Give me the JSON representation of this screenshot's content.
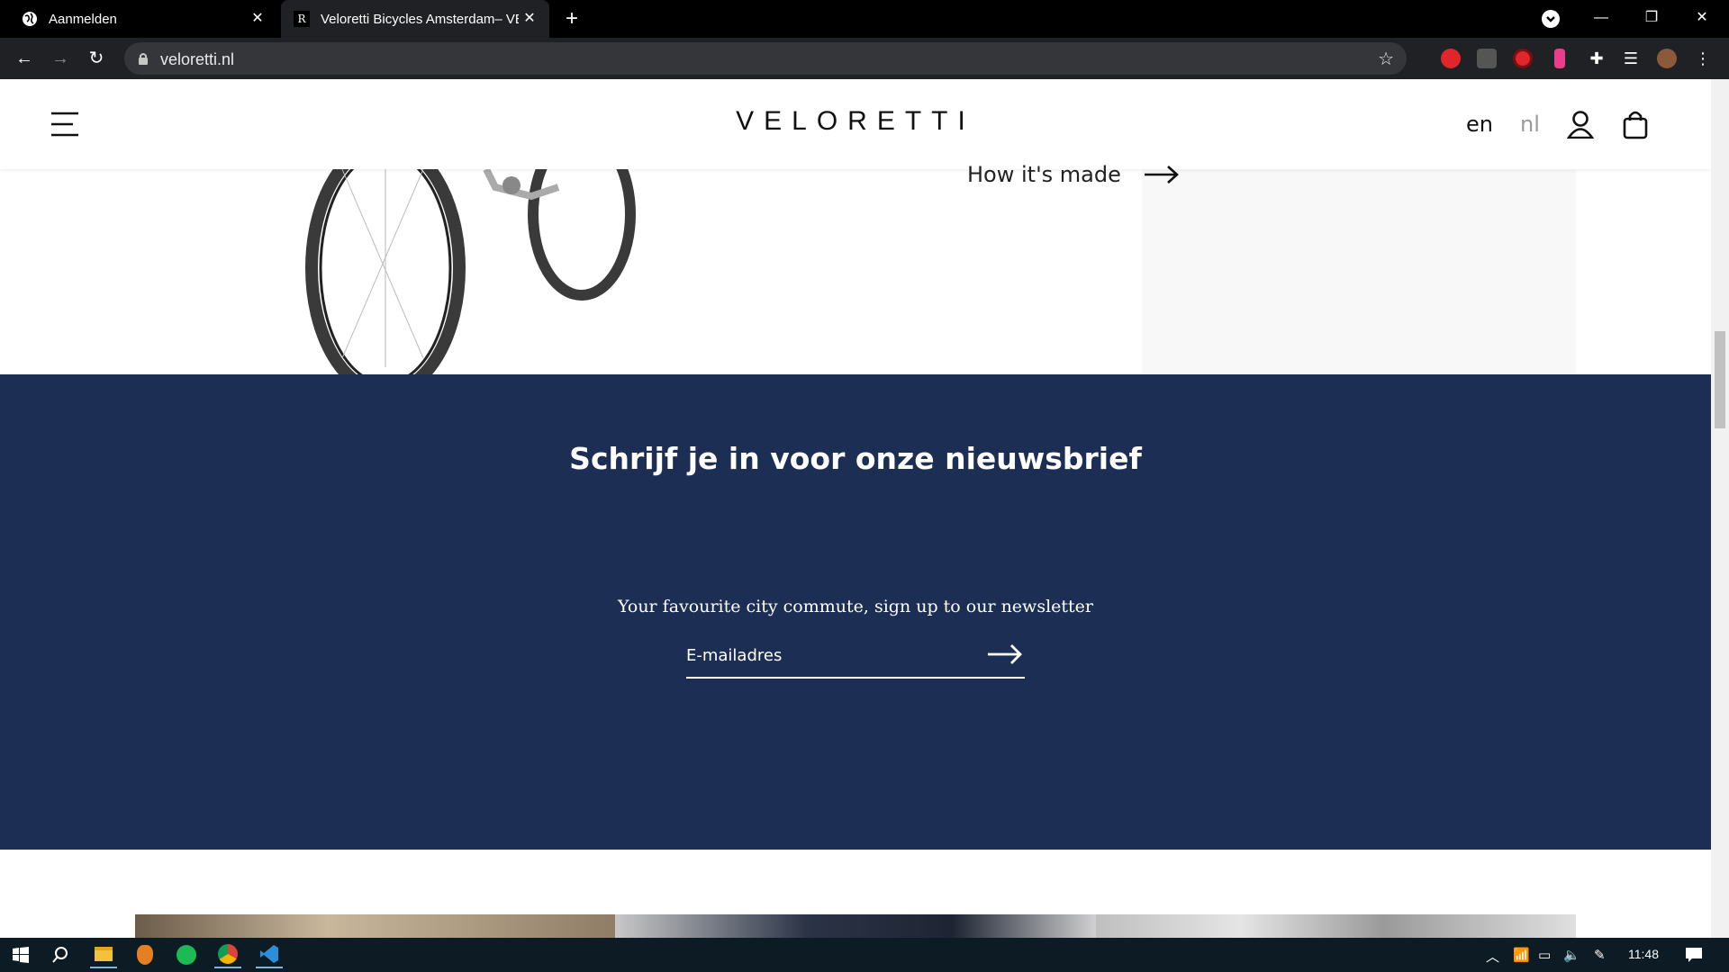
{
  "browser": {
    "tabs": [
      {
        "title": "Aanmelden",
        "active": false
      },
      {
        "title": "Veloretti Bicycles Amsterdam– VE",
        "active": true,
        "favicon_letter": "R"
      }
    ],
    "url": "veloretti.nl"
  },
  "site": {
    "logo": "VELORETTI",
    "lang_en": "en",
    "lang_nl": "nl",
    "how_its_made": "How it's made"
  },
  "newsletter": {
    "title": "Schrijf je in voor onze nieuwsbrief",
    "subtitle": "Your favourite city commute, sign up to our newsletter",
    "email_placeholder": "E-mailadres"
  },
  "taskbar": {
    "time": "11:48"
  },
  "colors": {
    "newsletter_bg": "#1c2e53",
    "browser_dark": "#202124"
  }
}
